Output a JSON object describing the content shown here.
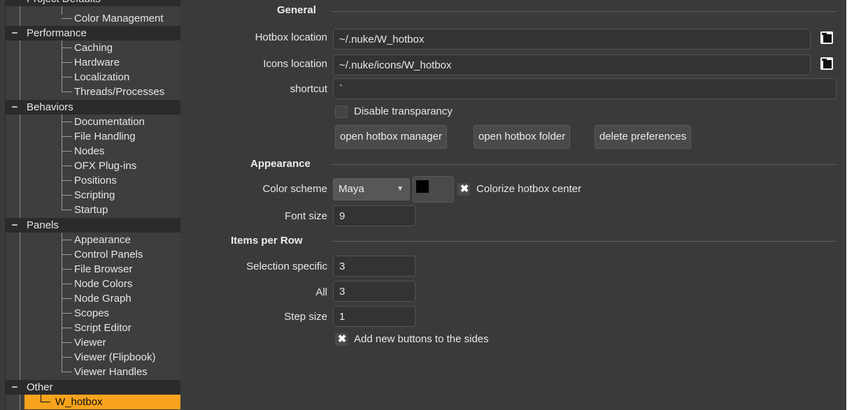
{
  "tree": {
    "top_partial": "Project Defaults",
    "categories": [
      {
        "label": "Performance",
        "toggle": "−"
      },
      {
        "label": "Behaviors",
        "toggle": "−"
      },
      {
        "label": "Panels",
        "toggle": "−"
      },
      {
        "label": "Other",
        "toggle": "−"
      }
    ],
    "items": {
      "color_management": "Color Management",
      "caching": "Caching",
      "hardware": "Hardware",
      "localization": "Localization",
      "threads": "Threads/Processes",
      "documentation": "Documentation",
      "file_handling": "File Handling",
      "nodes": "Nodes",
      "ofx": "OFX Plug-ins",
      "positions": "Positions",
      "scripting": "Scripting",
      "startup": "Startup",
      "appearance": "Appearance",
      "control_panels": "Control Panels",
      "file_browser": "File Browser",
      "node_colors": "Node Colors",
      "node_graph": "Node Graph",
      "scopes": "Scopes",
      "script_editor": "Script Editor",
      "viewer": "Viewer",
      "viewer_flipbook": "Viewer (Flipbook)",
      "viewer_handles": "Viewer Handles",
      "w_hotbox": "W_hotbox"
    },
    "selected_color": "#f7a31c"
  },
  "general": {
    "title": "General",
    "hotbox_location_label": "Hotbox location",
    "hotbox_location_value": "~/.nuke/W_hotbox",
    "icons_location_label": "Icons location",
    "icons_location_value": "~/.nuke/icons/W_hotbox",
    "shortcut_label": "shortcut",
    "shortcut_value": "`",
    "disable_transparency_label": "Disable transparancy",
    "buttons": {
      "open_manager": "open hotbox manager",
      "open_folder": "open hotbox folder",
      "delete_prefs": "delete preferences"
    }
  },
  "appearance": {
    "title": "Appearance",
    "color_scheme_label": "Color scheme",
    "color_scheme_value": "Maya",
    "color_scheme_arrow": "▼",
    "colorize_label": "Colorize hotbox center",
    "colorize_checked_mark": "✖",
    "font_size_label": "Font size",
    "font_size_value": "9"
  },
  "items_per_row": {
    "title": "Items per Row",
    "selection_specific_label": "Selection specific",
    "selection_specific_value": "3",
    "all_label": "All",
    "all_value": "3",
    "step_size_label": "Step size",
    "step_size_value": "1",
    "add_sides_label": "Add new buttons to the sides",
    "add_sides_checked_mark": "✖"
  }
}
